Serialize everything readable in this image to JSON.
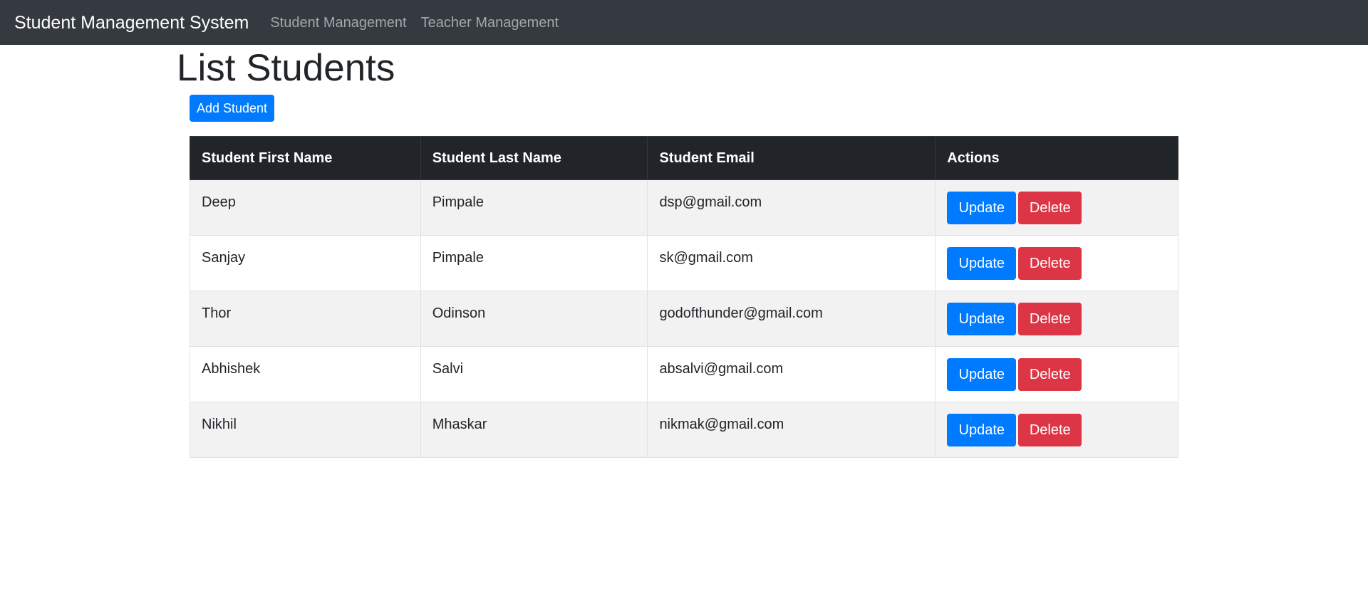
{
  "navbar": {
    "brand": "Student Management System",
    "links": [
      "Student Management",
      "Teacher Management"
    ],
    "background": "#343a40"
  },
  "page": {
    "title": "List Students",
    "add_button_label": "Add Student"
  },
  "table": {
    "headers": [
      "Student First Name",
      "Student Last Name",
      "Student Email",
      "Actions"
    ],
    "rows": [
      {
        "first": "Deep",
        "last": "Pimpale",
        "email": "dsp@gmail.com"
      },
      {
        "first": "Sanjay",
        "last": "Pimpale",
        "email": "sk@gmail.com"
      },
      {
        "first": "Thor",
        "last": "Odinson",
        "email": "godofthunder@gmail.com"
      },
      {
        "first": "Abhishek",
        "last": "Salvi",
        "email": "absalvi@gmail.com"
      },
      {
        "first": "Nikhil",
        "last": "Mhaskar",
        "email": "nikmak@gmail.com"
      }
    ],
    "update_label": "Update",
    "delete_label": "Delete"
  },
  "colors": {
    "primary": "#007bff",
    "danger": "#dc3545",
    "table_header": "#212529"
  }
}
